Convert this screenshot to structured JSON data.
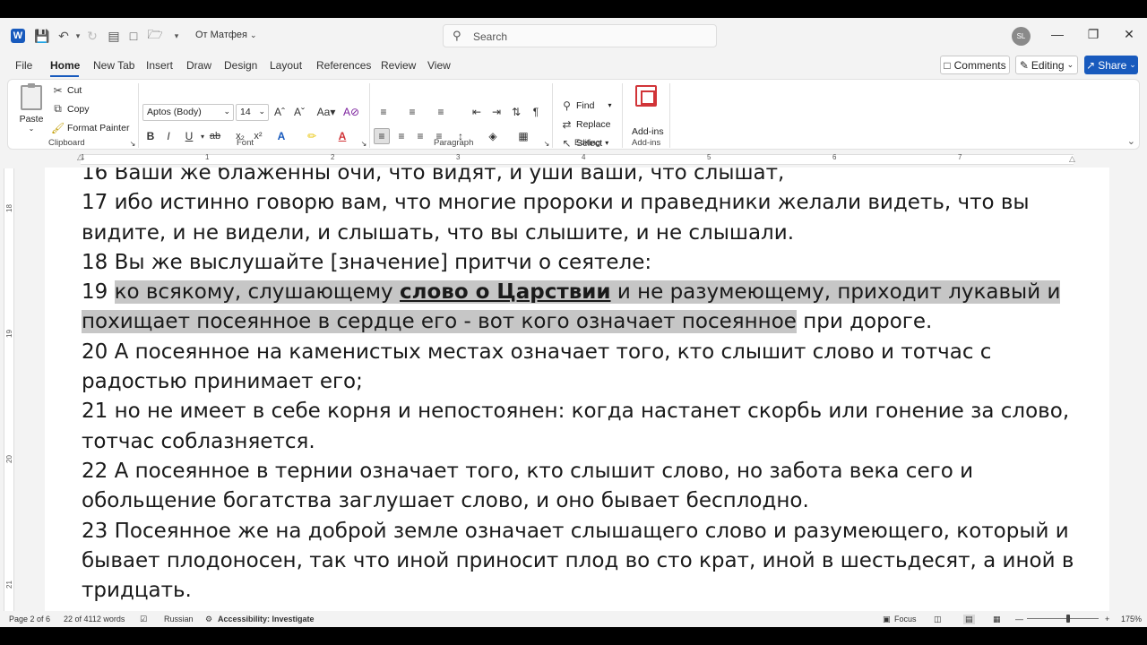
{
  "titlebar": {
    "doc_title": "От Матфея",
    "search_placeholder": "Search",
    "avatar_initials": "SL"
  },
  "tabs": [
    "File",
    "Home",
    "New Tab",
    "Insert",
    "Draw",
    "Design",
    "Layout",
    "References",
    "Review",
    "View"
  ],
  "actions": {
    "comments": "Comments",
    "editing": "Editing",
    "share": "Share"
  },
  "ribbon": {
    "clipboard": {
      "paste": "Paste",
      "cut": "Cut",
      "copy": "Copy",
      "format_painter": "Format Painter",
      "label": "Clipboard"
    },
    "font": {
      "font_name": "Aptos (Body)",
      "font_size": "14",
      "label": "Font"
    },
    "paragraph": {
      "label": "Paragraph"
    },
    "editing": {
      "find": "Find",
      "replace": "Replace",
      "select": "Select",
      "label": "Editing"
    },
    "addins": {
      "button": "Add-ins",
      "label": "Add-ins"
    }
  },
  "ruler": {
    "numbers": [
      "1",
      "1",
      "2",
      "3",
      "4",
      "5",
      "6",
      "7"
    ]
  },
  "vruler": {
    "numbers": [
      "18",
      "19",
      "20",
      "21"
    ]
  },
  "document": {
    "line_top": "16 Ваши же блаженны очи, что видят, и уши ваши, что слышат,",
    "p17": "17 ибо истинно говорю вам, что многие пророки и праведники желали видеть, что вы видите, и не видели, и слышать, что вы слышите, и не слышали.",
    "p18": "18 Вы же выслушайте [значение] притчи о сеятеле:",
    "p19_num": "19 ",
    "p19_hl1": "ко всякому, слушающему ",
    "p19_bold": "слово о Царствии",
    "p19_hl2": " и не разумеющему, приходит лукавый и похищает посеянное в сердце его - вот кого означает посеянное",
    "p19_rest": " при дороге.",
    "p20": "20 А посеянное на каменистых местах означает того, кто слышит слово и тотчас с радостью принимает его;",
    "p21": "21 но не имеет в себе корня и непостоянен: когда настанет скорбь или гонение за слово, тотчас соблазняется.",
    "p22": "22 А посеянное в тернии означает того, кто слышит слово, но забота века сего и обольщение богатства заглушает слово, и оно бывает бесплодно.",
    "p23": "23 Посеянное же на доброй земле означает слышащего слово и разумеющего, который и бывает плодоносен, так что иной приносит плод во сто крат, иной в шестьдесят, а иной в тридцать."
  },
  "status": {
    "page": "Page 2 of 6",
    "words": "22 of 4112 words",
    "language": "Russian",
    "accessibility": "Accessibility: Investigate",
    "focus": "Focus",
    "zoom": "175%",
    "zoom_level": 0.58
  }
}
